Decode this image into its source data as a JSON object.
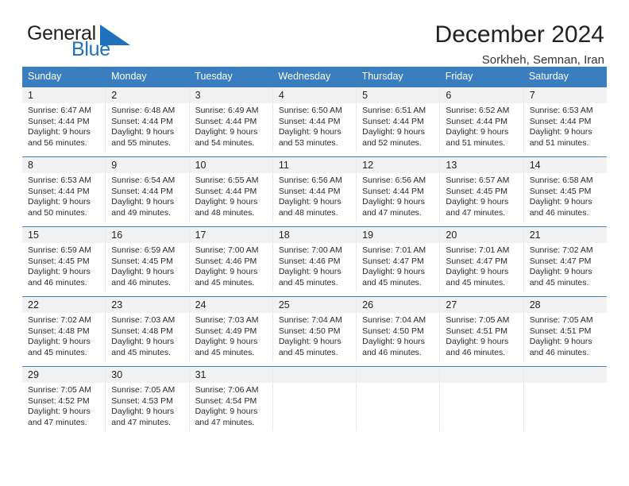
{
  "logo": {
    "word_one": "General",
    "word_two": "Blue",
    "flag_icon": "blue-triangle-flag-icon",
    "brand_color": "#1d72bb"
  },
  "header": {
    "month_title": "December 2024",
    "location": "Sorkheh, Semnan, Iran"
  },
  "calendar": {
    "accent_color": "#3a7ec0",
    "daynum_band_color": "#f2f2f2",
    "weekdays": [
      "Sunday",
      "Monday",
      "Tuesday",
      "Wednesday",
      "Thursday",
      "Friday",
      "Saturday"
    ],
    "weeks": [
      [
        {
          "day": "1",
          "sunrise": "Sunrise: 6:47 AM",
          "sunset": "Sunset: 4:44 PM",
          "daylight_line1": "Daylight: 9 hours",
          "daylight_line2": "and 56 minutes."
        },
        {
          "day": "2",
          "sunrise": "Sunrise: 6:48 AM",
          "sunset": "Sunset: 4:44 PM",
          "daylight_line1": "Daylight: 9 hours",
          "daylight_line2": "and 55 minutes."
        },
        {
          "day": "3",
          "sunrise": "Sunrise: 6:49 AM",
          "sunset": "Sunset: 4:44 PM",
          "daylight_line1": "Daylight: 9 hours",
          "daylight_line2": "and 54 minutes."
        },
        {
          "day": "4",
          "sunrise": "Sunrise: 6:50 AM",
          "sunset": "Sunset: 4:44 PM",
          "daylight_line1": "Daylight: 9 hours",
          "daylight_line2": "and 53 minutes."
        },
        {
          "day": "5",
          "sunrise": "Sunrise: 6:51 AM",
          "sunset": "Sunset: 4:44 PM",
          "daylight_line1": "Daylight: 9 hours",
          "daylight_line2": "and 52 minutes."
        },
        {
          "day": "6",
          "sunrise": "Sunrise: 6:52 AM",
          "sunset": "Sunset: 4:44 PM",
          "daylight_line1": "Daylight: 9 hours",
          "daylight_line2": "and 51 minutes."
        },
        {
          "day": "7",
          "sunrise": "Sunrise: 6:53 AM",
          "sunset": "Sunset: 4:44 PM",
          "daylight_line1": "Daylight: 9 hours",
          "daylight_line2": "and 51 minutes."
        }
      ],
      [
        {
          "day": "8",
          "sunrise": "Sunrise: 6:53 AM",
          "sunset": "Sunset: 4:44 PM",
          "daylight_line1": "Daylight: 9 hours",
          "daylight_line2": "and 50 minutes."
        },
        {
          "day": "9",
          "sunrise": "Sunrise: 6:54 AM",
          "sunset": "Sunset: 4:44 PM",
          "daylight_line1": "Daylight: 9 hours",
          "daylight_line2": "and 49 minutes."
        },
        {
          "day": "10",
          "sunrise": "Sunrise: 6:55 AM",
          "sunset": "Sunset: 4:44 PM",
          "daylight_line1": "Daylight: 9 hours",
          "daylight_line2": "and 48 minutes."
        },
        {
          "day": "11",
          "sunrise": "Sunrise: 6:56 AM",
          "sunset": "Sunset: 4:44 PM",
          "daylight_line1": "Daylight: 9 hours",
          "daylight_line2": "and 48 minutes."
        },
        {
          "day": "12",
          "sunrise": "Sunrise: 6:56 AM",
          "sunset": "Sunset: 4:44 PM",
          "daylight_line1": "Daylight: 9 hours",
          "daylight_line2": "and 47 minutes."
        },
        {
          "day": "13",
          "sunrise": "Sunrise: 6:57 AM",
          "sunset": "Sunset: 4:45 PM",
          "daylight_line1": "Daylight: 9 hours",
          "daylight_line2": "and 47 minutes."
        },
        {
          "day": "14",
          "sunrise": "Sunrise: 6:58 AM",
          "sunset": "Sunset: 4:45 PM",
          "daylight_line1": "Daylight: 9 hours",
          "daylight_line2": "and 46 minutes."
        }
      ],
      [
        {
          "day": "15",
          "sunrise": "Sunrise: 6:59 AM",
          "sunset": "Sunset: 4:45 PM",
          "daylight_line1": "Daylight: 9 hours",
          "daylight_line2": "and 46 minutes."
        },
        {
          "day": "16",
          "sunrise": "Sunrise: 6:59 AM",
          "sunset": "Sunset: 4:45 PM",
          "daylight_line1": "Daylight: 9 hours",
          "daylight_line2": "and 46 minutes."
        },
        {
          "day": "17",
          "sunrise": "Sunrise: 7:00 AM",
          "sunset": "Sunset: 4:46 PM",
          "daylight_line1": "Daylight: 9 hours",
          "daylight_line2": "and 45 minutes."
        },
        {
          "day": "18",
          "sunrise": "Sunrise: 7:00 AM",
          "sunset": "Sunset: 4:46 PM",
          "daylight_line1": "Daylight: 9 hours",
          "daylight_line2": "and 45 minutes."
        },
        {
          "day": "19",
          "sunrise": "Sunrise: 7:01 AM",
          "sunset": "Sunset: 4:47 PM",
          "daylight_line1": "Daylight: 9 hours",
          "daylight_line2": "and 45 minutes."
        },
        {
          "day": "20",
          "sunrise": "Sunrise: 7:01 AM",
          "sunset": "Sunset: 4:47 PM",
          "daylight_line1": "Daylight: 9 hours",
          "daylight_line2": "and 45 minutes."
        },
        {
          "day": "21",
          "sunrise": "Sunrise: 7:02 AM",
          "sunset": "Sunset: 4:47 PM",
          "daylight_line1": "Daylight: 9 hours",
          "daylight_line2": "and 45 minutes."
        }
      ],
      [
        {
          "day": "22",
          "sunrise": "Sunrise: 7:02 AM",
          "sunset": "Sunset: 4:48 PM",
          "daylight_line1": "Daylight: 9 hours",
          "daylight_line2": "and 45 minutes."
        },
        {
          "day": "23",
          "sunrise": "Sunrise: 7:03 AM",
          "sunset": "Sunset: 4:48 PM",
          "daylight_line1": "Daylight: 9 hours",
          "daylight_line2": "and 45 minutes."
        },
        {
          "day": "24",
          "sunrise": "Sunrise: 7:03 AM",
          "sunset": "Sunset: 4:49 PM",
          "daylight_line1": "Daylight: 9 hours",
          "daylight_line2": "and 45 minutes."
        },
        {
          "day": "25",
          "sunrise": "Sunrise: 7:04 AM",
          "sunset": "Sunset: 4:50 PM",
          "daylight_line1": "Daylight: 9 hours",
          "daylight_line2": "and 45 minutes."
        },
        {
          "day": "26",
          "sunrise": "Sunrise: 7:04 AM",
          "sunset": "Sunset: 4:50 PM",
          "daylight_line1": "Daylight: 9 hours",
          "daylight_line2": "and 46 minutes."
        },
        {
          "day": "27",
          "sunrise": "Sunrise: 7:05 AM",
          "sunset": "Sunset: 4:51 PM",
          "daylight_line1": "Daylight: 9 hours",
          "daylight_line2": "and 46 minutes."
        },
        {
          "day": "28",
          "sunrise": "Sunrise: 7:05 AM",
          "sunset": "Sunset: 4:51 PM",
          "daylight_line1": "Daylight: 9 hours",
          "daylight_line2": "and 46 minutes."
        }
      ],
      [
        {
          "day": "29",
          "sunrise": "Sunrise: 7:05 AM",
          "sunset": "Sunset: 4:52 PM",
          "daylight_line1": "Daylight: 9 hours",
          "daylight_line2": "and 47 minutes."
        },
        {
          "day": "30",
          "sunrise": "Sunrise: 7:05 AM",
          "sunset": "Sunset: 4:53 PM",
          "daylight_line1": "Daylight: 9 hours",
          "daylight_line2": "and 47 minutes."
        },
        {
          "day": "31",
          "sunrise": "Sunrise: 7:06 AM",
          "sunset": "Sunset: 4:54 PM",
          "daylight_line1": "Daylight: 9 hours",
          "daylight_line2": "and 47 minutes."
        },
        {
          "day": "",
          "sunrise": "",
          "sunset": "",
          "daylight_line1": "",
          "daylight_line2": ""
        },
        {
          "day": "",
          "sunrise": "",
          "sunset": "",
          "daylight_line1": "",
          "daylight_line2": ""
        },
        {
          "day": "",
          "sunrise": "",
          "sunset": "",
          "daylight_line1": "",
          "daylight_line2": ""
        },
        {
          "day": "",
          "sunrise": "",
          "sunset": "",
          "daylight_line1": "",
          "daylight_line2": ""
        }
      ]
    ]
  }
}
